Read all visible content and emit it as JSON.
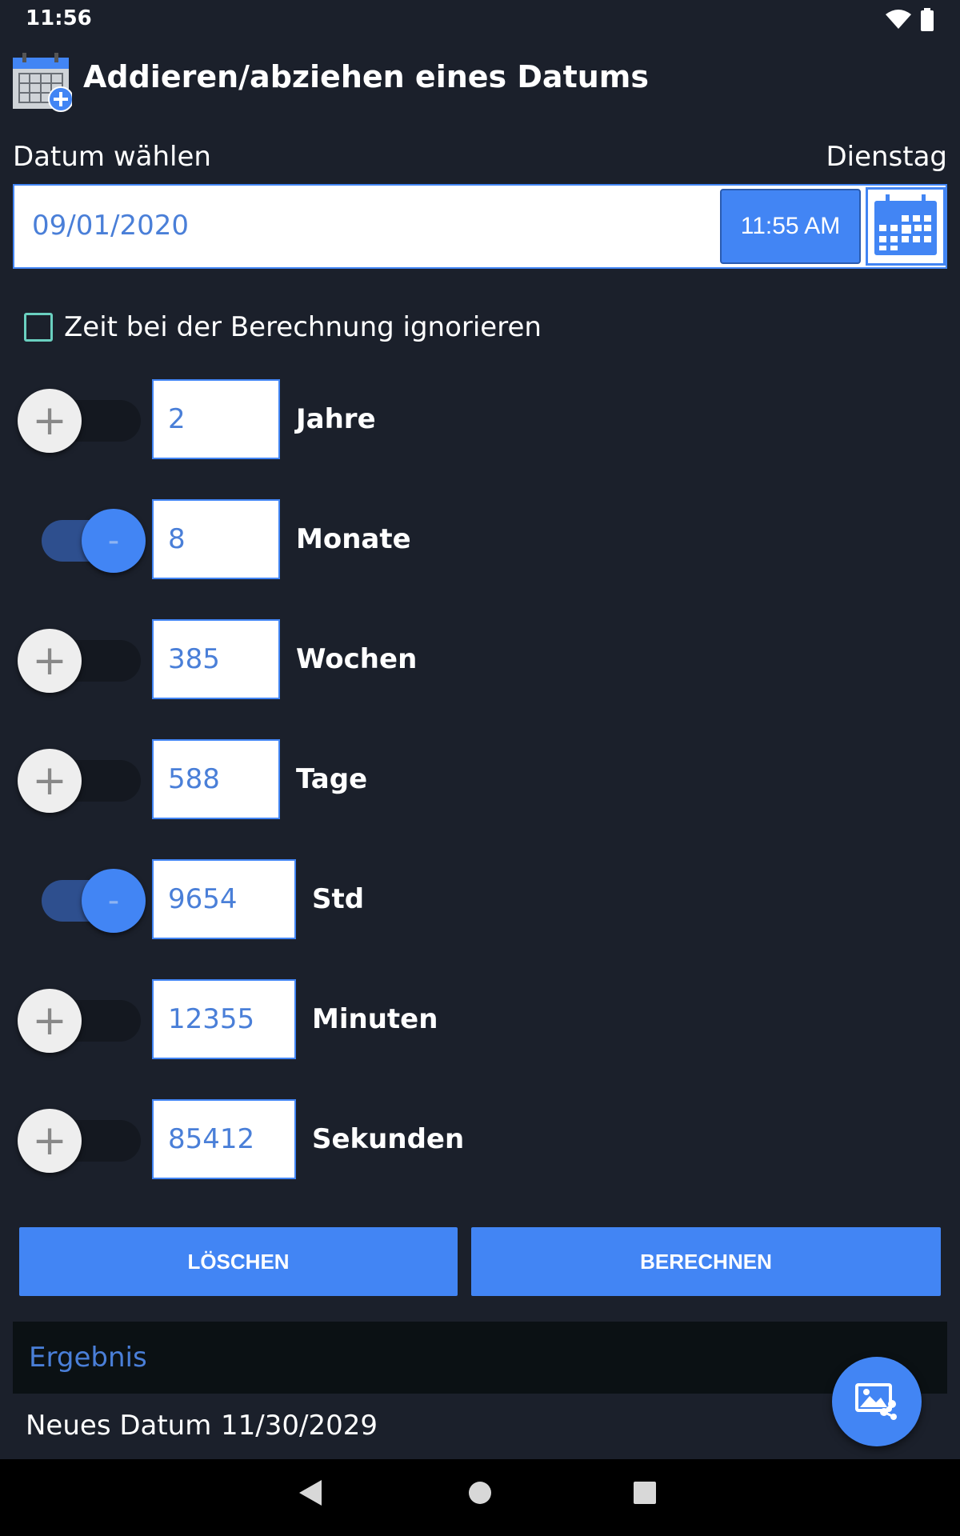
{
  "status_bar": {
    "time": "11:56",
    "wifi_icon": "wifi-icon",
    "battery_icon": "battery-icon"
  },
  "header": {
    "title": "Addieren/abziehen eines Datums",
    "icon": "calendar-add-icon"
  },
  "date_picker": {
    "label": "Datum wählen",
    "weekday": "Dienstag",
    "date_value": "09/01/2020",
    "time_button": "11:55 AM",
    "calendar_icon": "calendar-icon"
  },
  "ignore_time": {
    "label": "Zeit bei der Berechnung ignorieren",
    "checked": false
  },
  "rows": [
    {
      "unit": "Jahre",
      "value": "2",
      "sign": "+"
    },
    {
      "unit": "Monate",
      "value": "8",
      "sign": "-"
    },
    {
      "unit": "Wochen",
      "value": "385",
      "sign": "+"
    },
    {
      "unit": "Tage",
      "value": "588",
      "sign": "+"
    },
    {
      "unit": "Std",
      "value": "9654",
      "sign": "-"
    },
    {
      "unit": "Minuten",
      "value": "12355",
      "sign": "+"
    },
    {
      "unit": "Sekunden",
      "value": "85412",
      "sign": "+"
    }
  ],
  "buttons": {
    "clear": "LÖSCHEN",
    "calculate": "BERECHNEN"
  },
  "result": {
    "title": "Ergebnis",
    "label": "Neues Datum",
    "value": "11/30/2029"
  },
  "fab_icon": "share-image-icon",
  "colors": {
    "background": "#1b202b",
    "accent": "#4285f4",
    "field_text": "#4a7fd8"
  }
}
